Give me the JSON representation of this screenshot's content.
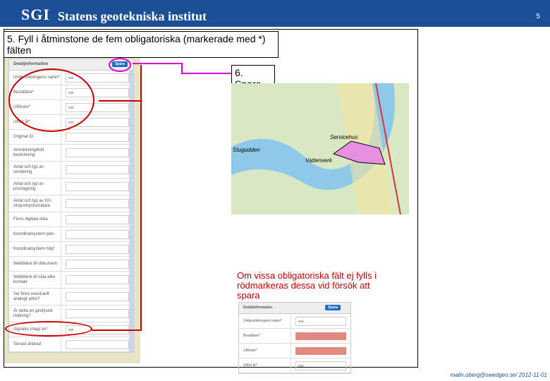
{
  "header": {
    "logo": "SGI",
    "org": "Statens geotekniska institut",
    "page": "5"
  },
  "step5": "5. Fyll i åtminstone de fem obligatoriska (markerade med *) fälten",
  "step6": "6. Spara",
  "panel": {
    "title": "Detaljinformation",
    "save": "Spara",
    "fields": [
      {
        "label": "Undersökningens namn*",
        "value": "xxx"
      },
      {
        "label": "Beställare*",
        "value": "xxx"
      },
      {
        "label": "Utförare*",
        "value": "xxx"
      },
      {
        "label": "Utfört år*",
        "value": "xxx"
      },
      {
        "label": "Original ID",
        "value": ""
      },
      {
        "label": "Anmärkning/kort beskrivning",
        "value": ""
      },
      {
        "label": "Antal och typ av sondering",
        "value": ""
      },
      {
        "label": "Antal och typ av provtagning",
        "value": ""
      },
      {
        "label": "Antal och typ av GV-rör/portrycksmätare",
        "value": ""
      },
      {
        "label": "Finns digitala data",
        "value": ""
      },
      {
        "label": "Koordinatsystem plan",
        "value": ""
      },
      {
        "label": "Koordinatsystem höjd",
        "value": ""
      },
      {
        "label": "Webblänk till dokument",
        "value": ""
      },
      {
        "label": "Webblänk till sida eller kontakt",
        "value": ""
      },
      {
        "label": "Var finns eventuellt analogt arkiv?",
        "value": ""
      },
      {
        "label": "Är detta en geofysisk mätning?",
        "value": ""
      },
      {
        "label": "Signatur inlagt av*",
        "value": "xxx"
      },
      {
        "label": "Senast ändrad",
        "value": ""
      }
    ]
  },
  "map": {
    "labels": [
      "Servicehus",
      "Vattenverk",
      "Stugudden"
    ]
  },
  "note": "Om vissa obligatoriska fält ej fylls i rödmarkeras dessa vid försök att spara",
  "panel2": {
    "title": "Detaljinformation",
    "save": "Spara",
    "fields": [
      {
        "label": "Undersökningens namn*",
        "value": "xxx"
      },
      {
        "label": "Beställare*",
        "value": ""
      },
      {
        "label": "Utförare*",
        "value": ""
      },
      {
        "label": "Utfört år*",
        "value": "xxx"
      }
    ]
  },
  "footer": "malin.oberg@swedgeo.se/ 2012-11-01"
}
